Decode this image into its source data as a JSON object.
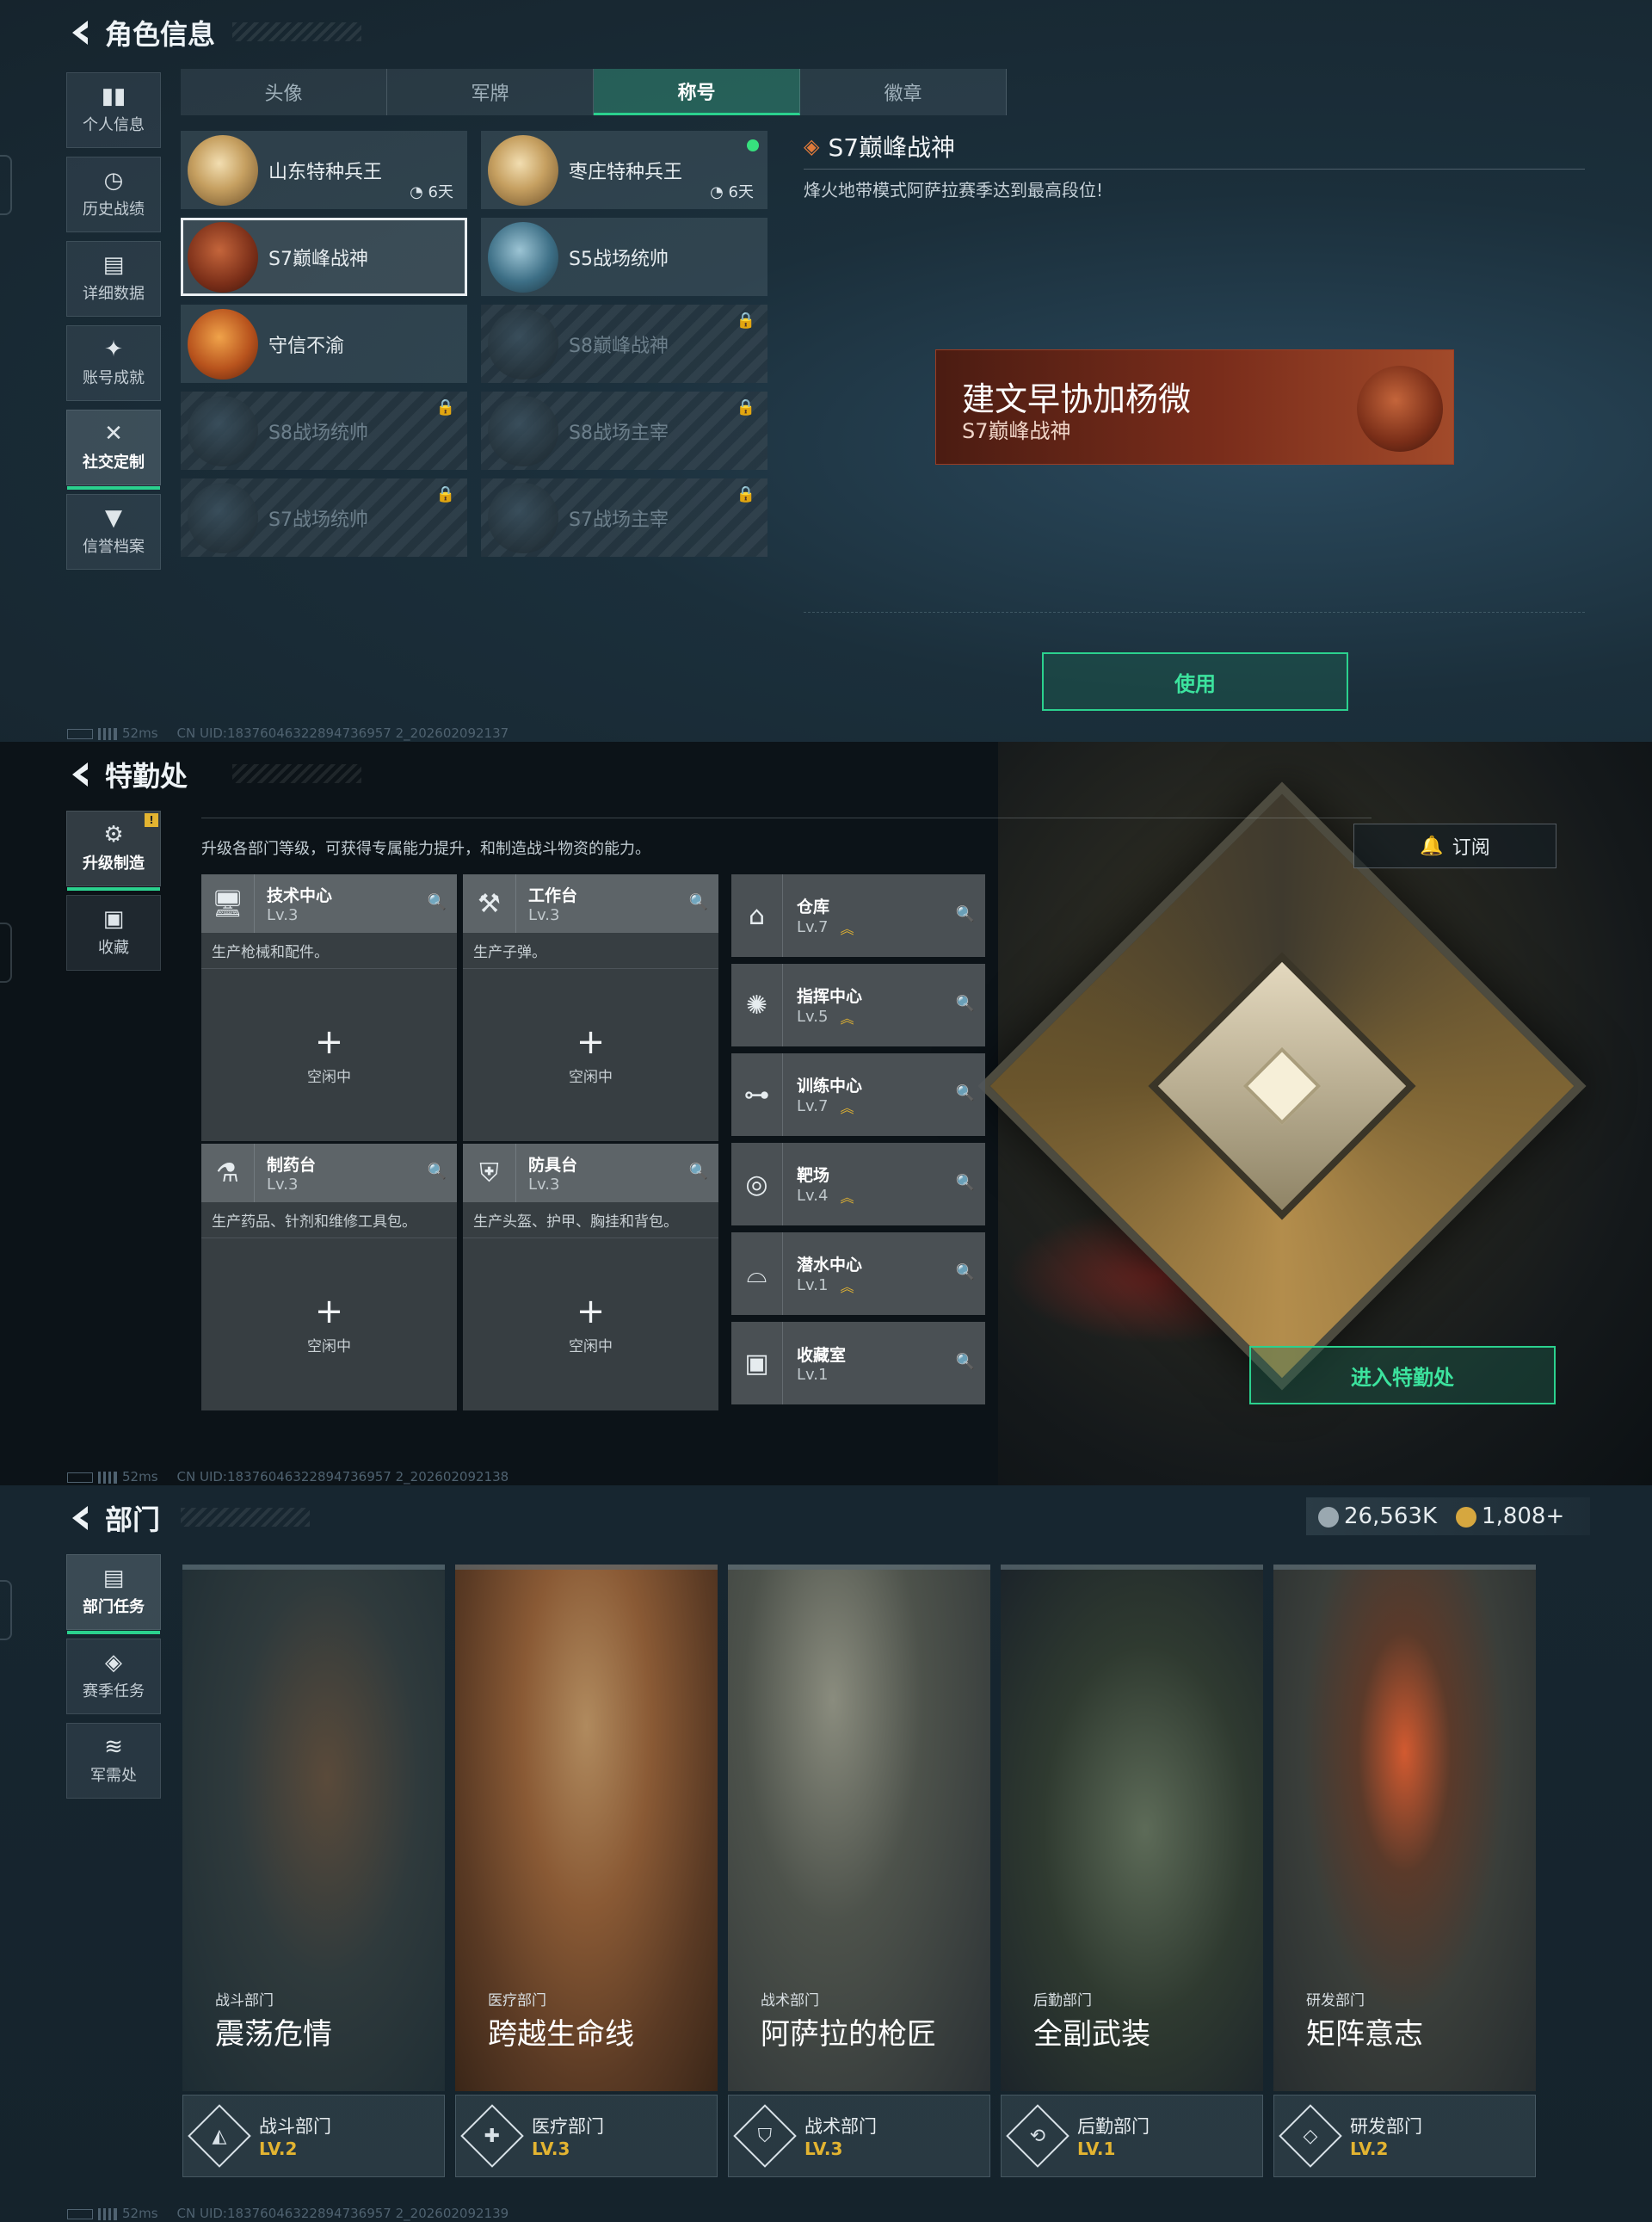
{
  "panel1": {
    "title": "角色信息",
    "sidenav": [
      {
        "label": "个人信息",
        "icon": "bar-chart-icon",
        "glyph": "▮▮",
        "active": false
      },
      {
        "label": "历史战绩",
        "icon": "history-icon",
        "glyph": "◷",
        "active": false
      },
      {
        "label": "详细数据",
        "icon": "folder-icon",
        "glyph": "▤",
        "active": false
      },
      {
        "label": "账号成就",
        "icon": "achievement-icon",
        "glyph": "✦",
        "active": false
      },
      {
        "label": "社交定制",
        "icon": "tools-icon",
        "glyph": "✕",
        "active": true
      },
      {
        "label": "信誉档案",
        "icon": "reputation-icon",
        "glyph": "▼",
        "active": false
      }
    ],
    "tabs": [
      {
        "label": "头像",
        "active": false
      },
      {
        "label": "军牌",
        "active": false
      },
      {
        "label": "称号",
        "active": true
      },
      {
        "label": "徽章",
        "active": false
      }
    ],
    "titles": [
      {
        "name": "山东特种兵王",
        "days": "6天",
        "medal": "m-gold",
        "locked": false,
        "selected": false,
        "new": false
      },
      {
        "name": "枣庄特种兵王",
        "days": "6天",
        "medal": "m-gold",
        "locked": false,
        "selected": false,
        "new": true
      },
      {
        "name": "S7巅峰战神",
        "days": "",
        "medal": "m-red",
        "locked": false,
        "selected": true,
        "new": false
      },
      {
        "name": "S5战场统帅",
        "days": "",
        "medal": "m-boat",
        "locked": false,
        "selected": false,
        "new": false
      },
      {
        "name": "守信不渝",
        "days": "",
        "medal": "m-orange",
        "locked": false,
        "selected": false,
        "new": false
      },
      {
        "name": "S8巅峰战神",
        "days": "",
        "medal": "m-dim",
        "locked": true,
        "selected": false,
        "new": false
      },
      {
        "name": "S8战场统帅",
        "days": "",
        "medal": "m-dim",
        "locked": true,
        "selected": false,
        "new": false
      },
      {
        "name": "S8战场主宰",
        "days": "",
        "medal": "m-dim",
        "locked": true,
        "selected": false,
        "new": false
      },
      {
        "name": "S7战场统帅",
        "days": "",
        "medal": "m-dim",
        "locked": true,
        "selected": false,
        "new": false
      },
      {
        "name": "S7战场主宰",
        "days": "",
        "medal": "m-dim",
        "locked": true,
        "selected": false,
        "new": false
      }
    ],
    "detail": {
      "title": "S7巅峰战神",
      "desc": "烽火地带模式阿萨拉赛季达到最高段位!",
      "player_name": "建文早协加杨微",
      "plate_title": "S7巅峰战神"
    },
    "use_button": "使用",
    "footer": {
      "ping": "52ms",
      "uid": "CN UID:18376046322894736957 2_202602092137"
    }
  },
  "panel2": {
    "title": "特勤处",
    "sidenav": [
      {
        "label": "升级制造",
        "icon": "upgrade-icon",
        "glyph": "⚙",
        "active": true
      },
      {
        "label": "收藏",
        "icon": "collection-icon",
        "glyph": "▣",
        "active": false
      }
    ],
    "description": "升级各部门等级，可获得专属能力提升，和制造战斗物资的能力。",
    "subscribe_button": "订阅",
    "workbenches": [
      {
        "name": "技术中心",
        "level": "Lv.3",
        "desc": "生产枪械和配件。",
        "icon": "computer-icon",
        "glyph": "🖥",
        "status": "空闲中"
      },
      {
        "name": "工作台",
        "level": "Lv.3",
        "desc": "生产子弹。",
        "icon": "wrench-icon",
        "glyph": "⚒",
        "status": "空闲中"
      },
      {
        "name": "制药台",
        "level": "Lv.3",
        "desc": "生产药品、针剂和维修工具包。",
        "icon": "microscope-icon",
        "glyph": "⚗",
        "status": "空闲中"
      },
      {
        "name": "防具台",
        "level": "Lv.3",
        "desc": "生产头盔、护甲、胸挂和背包。",
        "icon": "armor-icon",
        "glyph": "⛨",
        "status": "空闲中"
      }
    ],
    "facilities": [
      {
        "name": "仓库",
        "level": "Lv.7",
        "upgradable": true,
        "icon": "warehouse-icon",
        "glyph": "⌂"
      },
      {
        "name": "指挥中心",
        "level": "Lv.5",
        "upgradable": true,
        "icon": "command-icon",
        "glyph": "✺"
      },
      {
        "name": "训练中心",
        "level": "Lv.7",
        "upgradable": true,
        "icon": "dumbbell-icon",
        "glyph": "⊶"
      },
      {
        "name": "靶场",
        "level": "Lv.4",
        "upgradable": true,
        "icon": "target-icon",
        "glyph": "◎"
      },
      {
        "name": "潜水中心",
        "level": "Lv.1",
        "upgradable": true,
        "icon": "diving-icon",
        "glyph": "⌓"
      },
      {
        "name": "收藏室",
        "level": "Lv.1",
        "upgradable": false,
        "icon": "collection-room-icon",
        "glyph": "▣"
      }
    ],
    "enter_button": "进入特勤处",
    "footer": {
      "ping": "52ms",
      "uid": "CN UID:18376046322894736957 2_202602092138"
    }
  },
  "panel3": {
    "title": "部门",
    "currency": [
      {
        "value": "26,563K",
        "icon": "silver-coin-icon",
        "color": "#9aa8b0"
      },
      {
        "value": "1,808+",
        "icon": "gold-coin-icon",
        "color": "#d6a73f"
      }
    ],
    "sidenav": [
      {
        "label": "部门任务",
        "icon": "task-icon",
        "glyph": "▤",
        "active": true
      },
      {
        "label": "赛季任务",
        "icon": "season-icon",
        "glyph": "◈",
        "active": false
      },
      {
        "label": "军需处",
        "icon": "supply-icon",
        "glyph": "≋",
        "active": false
      }
    ],
    "departments": [
      {
        "category": "战斗部门",
        "title": "震荡危情",
        "name": "战斗部门",
        "level": "LV.2",
        "img": "img1",
        "glyph": "◭",
        "icon": "combat-dept-icon"
      },
      {
        "category": "医疗部门",
        "title": "跨越生命线",
        "name": "医疗部门",
        "level": "LV.3",
        "img": "img2",
        "glyph": "✚",
        "icon": "medical-dept-icon"
      },
      {
        "category": "战术部门",
        "title": "阿萨拉的枪匠",
        "name": "战术部门",
        "level": "LV.3",
        "img": "img3",
        "glyph": "⛉",
        "icon": "tactical-dept-icon"
      },
      {
        "category": "后勤部门",
        "title": "全副武装",
        "name": "后勤部门",
        "level": "LV.1",
        "img": "img4",
        "glyph": "⟲",
        "icon": "logistics-dept-icon"
      },
      {
        "category": "研发部门",
        "title": "矩阵意志",
        "name": "研发部门",
        "level": "LV.2",
        "img": "img5",
        "glyph": "◇",
        "icon": "research-dept-icon"
      }
    ],
    "footer": {
      "ping": "52ms",
      "uid": "CN UID:18376046322894736957 2_202602092139"
    }
  }
}
